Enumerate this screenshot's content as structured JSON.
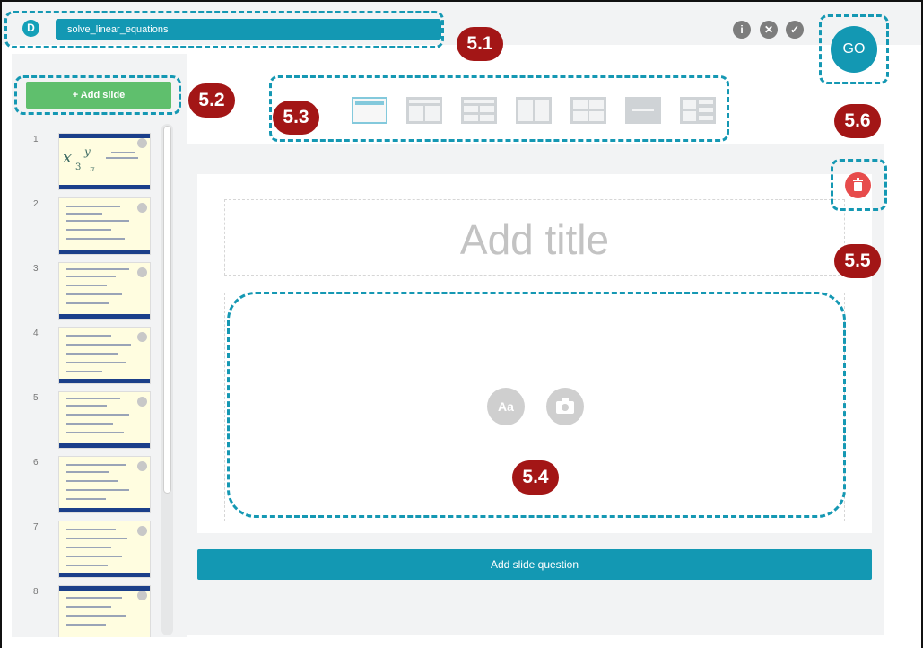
{
  "app": {
    "filename": "solve_linear_equations",
    "logo_letter": "D"
  },
  "toolbar": {
    "info_icon": "info-icon",
    "close_icon": "close-icon",
    "check_icon": "check-icon",
    "go_label": "GO"
  },
  "sidebar": {
    "add_slide_label": "+ Add slide",
    "slides": [
      "1",
      "2",
      "3",
      "4",
      "5",
      "6",
      "7",
      "8"
    ]
  },
  "layouts": [
    "title-only",
    "two-column-header",
    "grid-header",
    "two-column",
    "four-grid",
    "blank-line",
    "list"
  ],
  "slide": {
    "title_placeholder": "Add title",
    "text_button": "Aa",
    "add_question_label": "Add slide question"
  },
  "annotations": {
    "a51": "5.1",
    "a52": "5.2",
    "a53": "5.3",
    "a54": "5.4",
    "a55": "5.5",
    "a56": "5.6"
  },
  "colors": {
    "accent": "#1398b3",
    "green": "#5fbf6d",
    "badge": "#a31616",
    "delete": "#e74c4c"
  }
}
